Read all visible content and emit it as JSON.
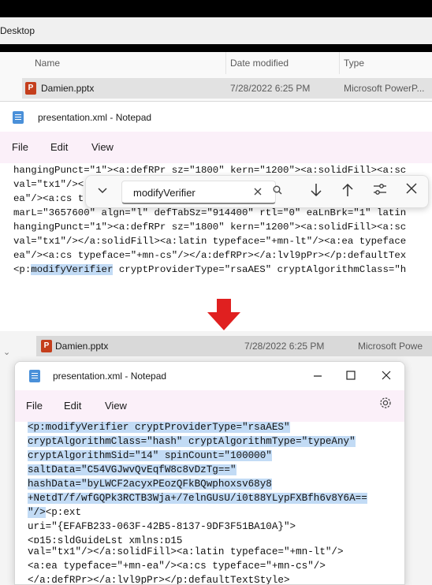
{
  "top": {
    "window_title": "Desktop",
    "columns": [
      "Name",
      "Date modified",
      "Type"
    ],
    "file": {
      "name": "Damien.pptx",
      "date": "7/28/2022 6:25 PM",
      "type": "Microsoft PowerP..."
    },
    "notepad": {
      "title": "presentation.xml - Notepad",
      "menu": [
        "File",
        "Edit",
        "View"
      ],
      "lines": [
        "hangingPunct=\"1\"><a:defRPr sz=\"1800\" kern=\"1200\"><a:solidFill><a:sc",
        "val=\"tx1\"/><",
        "ea\"/><a:cs t",
        "marL=\"3657600\" algn=\"l\" defTabSz=\"914400\" rtl=\"0\" eaLnBrk=\"1\" latin",
        "hangingPunct=\"1\"><a:defRPr sz=\"1800\" kern=\"1200\"><a:solidFill><a:sc",
        "val=\"tx1\"/></a:solidFill><a:latin typeface=\"+mn-lt\"/><a:ea typeface",
        "ea\"/><a:cs typeface=\"+mn-cs\"/></a:defRPr></a:lvl9pPr></p:defaultTex"
      ],
      "last_line_prefix": "<p:",
      "last_line_match": "modifyVerifier",
      "last_line_suffix": " cryptProviderType=\"rsaAES\" cryptAlgorithmClass=\"h"
    },
    "find": {
      "query": "modifyVerifier",
      "expand_icon": "chevron-down-icon",
      "clear_icon": "close-icon",
      "search_icon": "search-icon",
      "next_icon": "arrow-down-icon",
      "prev_icon": "arrow-up-icon",
      "options_icon": "sliders-icon",
      "close_icon": "close-icon"
    }
  },
  "arrow": {
    "color": "#e02020"
  },
  "bottom": {
    "file": {
      "name": "Damien.pptx",
      "date": "7/28/2022 6:25 PM",
      "type": "Microsoft Powe"
    },
    "notepad": {
      "title": "presentation.xml - Notepad",
      "menu": [
        "File",
        "Edit",
        "View"
      ],
      "selected_lines": [
        "<p:modifyVerifier cryptProviderType=\"rsaAES\"",
        "cryptAlgorithmClass=\"hash\" cryptAlgorithmType=\"typeAny\"",
        "cryptAlgorithmSid=\"14\" spinCount=\"100000\"",
        "saltData=\"C54VGJwvQvEqfW8c8vDzTg==\"",
        "hashData=\"byLWCF2acyxPEozQFkBQwphoxsv68y8",
        "+NetdT/f/wfGQPk3RCTB3Wja+/7elnGUsU/i0t88YLypFXBfh6v8Y6A==",
        "\"/>"
      ],
      "trailing_after_selection": "<p:ext",
      "lines": [
        "uri=\"{EFAFB233-063F-42B5-8137-9DF3F51BA10A}\">",
        "<p15:sldGuideLst xmlns:p15",
        "val=\"tx1\"/></a:solidFill><a:latin typeface=\"+mn-lt\"/>",
        "<a:ea typeface=\"+mn-ea\"/><a:cs typeface=\"+mn-cs\"/>",
        "</a:defRPr></a:lvl9pPr></p:defaultTextStyle>"
      ]
    }
  }
}
